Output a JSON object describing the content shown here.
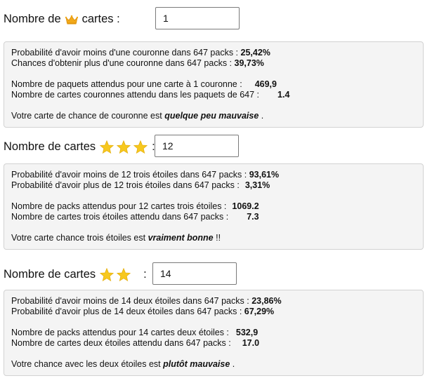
{
  "sections": [
    {
      "label_before": "Nombre de",
      "label_after": "cartes :",
      "icon": "crown-icon",
      "input_value": "1",
      "lines": [
        {
          "text": "Probabilité d'avoir moins d'une couronne dans 647 packs :",
          "value": "25,42%"
        },
        {
          "text": "Chances d'obtenir plus d'une couronne dans 647 packs :",
          "value": "39,73%"
        },
        {
          "text": "Nombre de paquets attendus pour une carte à 1 couronne :",
          "value": "469,9"
        },
        {
          "text": "Nombre de cartes couronnes attendu dans les paquets de 647 :",
          "value": "1.4"
        }
      ],
      "verdict_before": "Votre carte de chance de couronne est",
      "verdict_value": "quelque peu mauvaise",
      "verdict_after": "."
    },
    {
      "label_before": "Nombre de cartes",
      "label_after": ":",
      "icon": "star-icon",
      "stars": 3,
      "input_value": "12",
      "lines": [
        {
          "text": "Probabilité d'avoir moins de 12 trois étoiles dans 647 packs :",
          "value": "93,61%"
        },
        {
          "text": "Probabilité d'avoir plus de 12 trois étoiles dans 647 packs :",
          "value": "3,31%"
        },
        {
          "text": "Nombre de packs attendus pour 12 cartes trois étoiles :",
          "value": "1069.2"
        },
        {
          "text": "Nombre de cartes trois étoiles attendu dans 647 packs :",
          "value": "7.3"
        }
      ],
      "verdict_before": "Votre carte chance trois étoiles est",
      "verdict_value": "vraiment bonne",
      "verdict_after": "!!"
    },
    {
      "label_before": "Nombre de cartes",
      "label_after": ":",
      "icon": "star-icon",
      "stars": 2,
      "input_value": "14",
      "lines": [
        {
          "text": "Probabilité d'avoir moins de 14 deux étoiles dans 647 packs :",
          "value": "23,86%"
        },
        {
          "text": "Probabilité d'avoir plus de 14 deux étoiles dans 647 packs :",
          "value": "67,29%"
        },
        {
          "text": "Nombre de packs attendus pour 14 cartes deux étoiles :",
          "value": "532,9"
        },
        {
          "text": "Nombre de cartes deux étoiles attendu dans 647 packs :",
          "value": "17.0"
        }
      ],
      "verdict_before": "Votre chance avec les deux étoiles est",
      "verdict_value": "plutôt mauvaise",
      "verdict_after": "."
    }
  ],
  "colors": {
    "crown": "#f2a91a",
    "star": "#f7c81e",
    "card_bg": "#f4f4f4",
    "card_border": "#d2d2d2"
  }
}
